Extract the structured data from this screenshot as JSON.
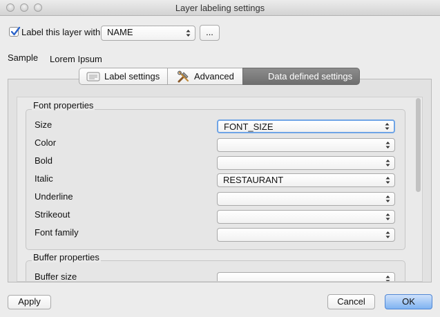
{
  "window": {
    "title": "Layer labeling settings"
  },
  "top": {
    "label_checkbox_text": "Label this layer with",
    "field_value": "NAME",
    "expression_button": "...",
    "sample_label": "Sample",
    "sample_text": "Lorem Ipsum"
  },
  "tabs": [
    {
      "label": "Label settings",
      "icon": "label-settings-icon",
      "selected": false
    },
    {
      "label": "Advanced",
      "icon": "tools-icon",
      "selected": false
    },
    {
      "label": "Data defined settings",
      "icon": "",
      "selected": true
    }
  ],
  "font_properties": {
    "title": "Font properties",
    "rows": [
      {
        "label": "Size",
        "value": "FONT_SIZE"
      },
      {
        "label": "Color",
        "value": ""
      },
      {
        "label": "Bold",
        "value": ""
      },
      {
        "label": "Italic",
        "value": "RESTAURANT"
      },
      {
        "label": "Underline",
        "value": ""
      },
      {
        "label": "Strikeout",
        "value": ""
      },
      {
        "label": "Font family",
        "value": ""
      }
    ]
  },
  "buffer_properties": {
    "title": "Buffer properties",
    "rows": [
      {
        "label": "Buffer size",
        "value": ""
      }
    ]
  },
  "footer": {
    "apply": "Apply",
    "cancel": "Cancel",
    "ok": "OK"
  },
  "colors": {
    "accent": "#7fb3f1",
    "selected_tab": "#7d7d7d",
    "focus_ring": "#6fa4e6"
  }
}
